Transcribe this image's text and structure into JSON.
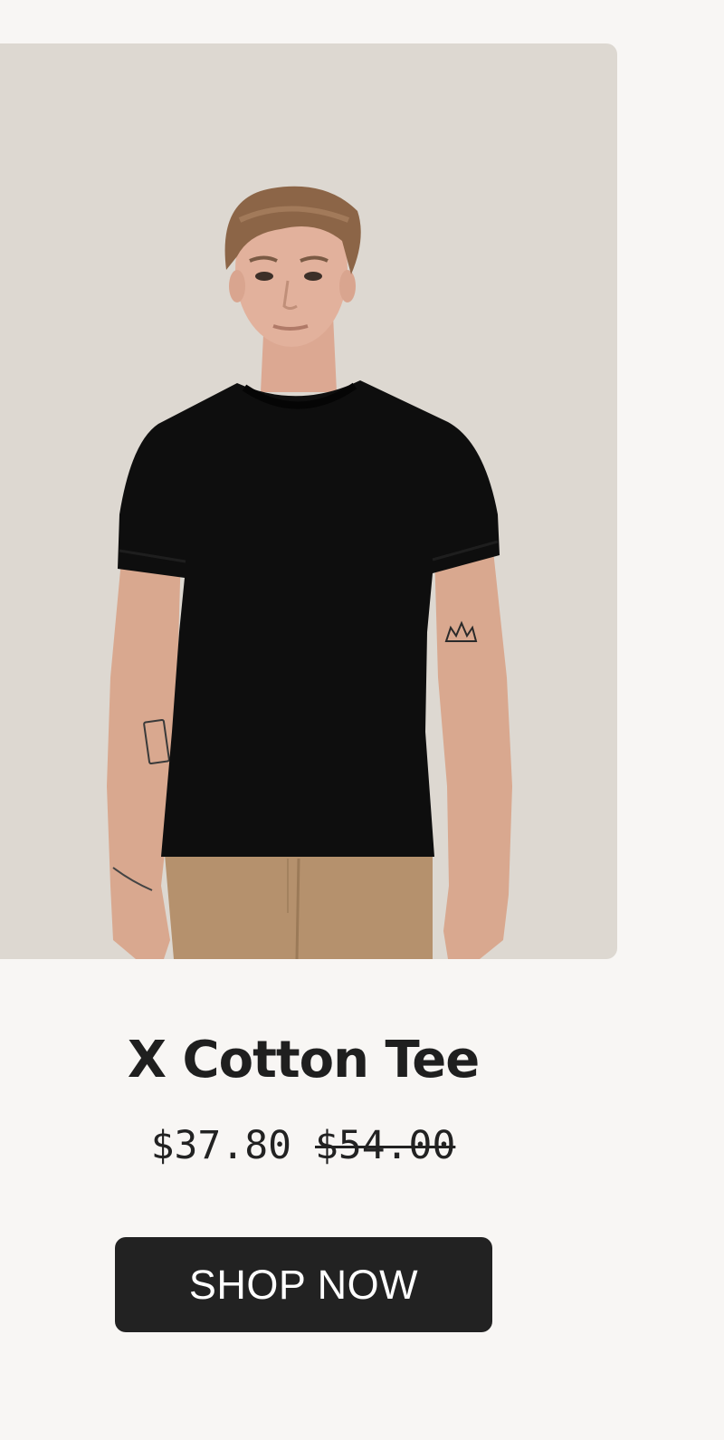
{
  "product": {
    "image_alt": "Man wearing a black crew neck t-shirt and tan chinos",
    "title": "X Cotton Tee",
    "sale_price": "$37.80",
    "original_price": "$54.00",
    "cta_label": "SHOP NOW"
  },
  "colors": {
    "page_background": "#f8f6f4",
    "image_background": "#ddd8d1",
    "text": "#1f1f1f",
    "button_background": "#222222",
    "button_text": "#ffffff"
  }
}
